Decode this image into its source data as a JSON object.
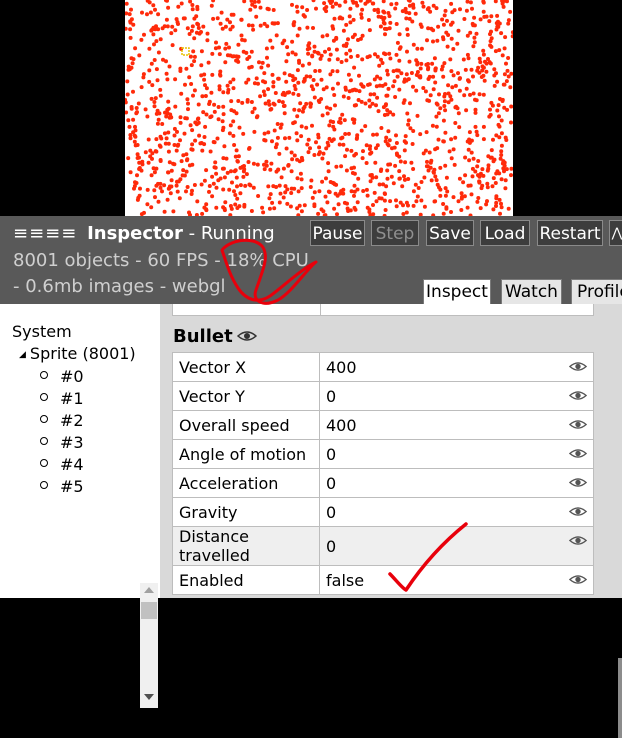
{
  "colors": {
    "particle": "#ff2a0a",
    "panel_header": "#595959",
    "annotation_red": "#e8000b"
  },
  "inspector": {
    "menu_glyph": "≡≡≡≡",
    "title": "Inspector",
    "status": "- Running",
    "stats_line1": "8001 objects - 60 FPS - 18% CPU",
    "stats_line2": "- 0.6mb images - webgl",
    "buttons": {
      "pause": "Pause",
      "step": "Step",
      "save": "Save",
      "load": "Load",
      "restart": "Restart",
      "collapse": "⋀"
    },
    "tabs": {
      "inspect": "Inspect",
      "watch": "Watch",
      "profile": "Profile"
    }
  },
  "tree": {
    "system": "System",
    "sprite": "Sprite (8001)",
    "instances": [
      "#0",
      "#1",
      "#2",
      "#3",
      "#4",
      "#5"
    ]
  },
  "properties": {
    "section": "Bullet",
    "rows": [
      {
        "name": "Vector X",
        "value": "400"
      },
      {
        "name": "Vector Y",
        "value": "0"
      },
      {
        "name": "Overall speed",
        "value": "400"
      },
      {
        "name": "Angle of motion",
        "value": "0"
      },
      {
        "name": "Acceleration",
        "value": "0"
      },
      {
        "name": "Gravity",
        "value": "0"
      },
      {
        "name": "Distance travelled",
        "value": "0"
      },
      {
        "name": "Enabled",
        "value": "false"
      }
    ]
  },
  "icons": [
    "hamburger-icon",
    "eye-icon",
    "tree-collapse-triangle-icon",
    "collapse-chevron-icon"
  ]
}
